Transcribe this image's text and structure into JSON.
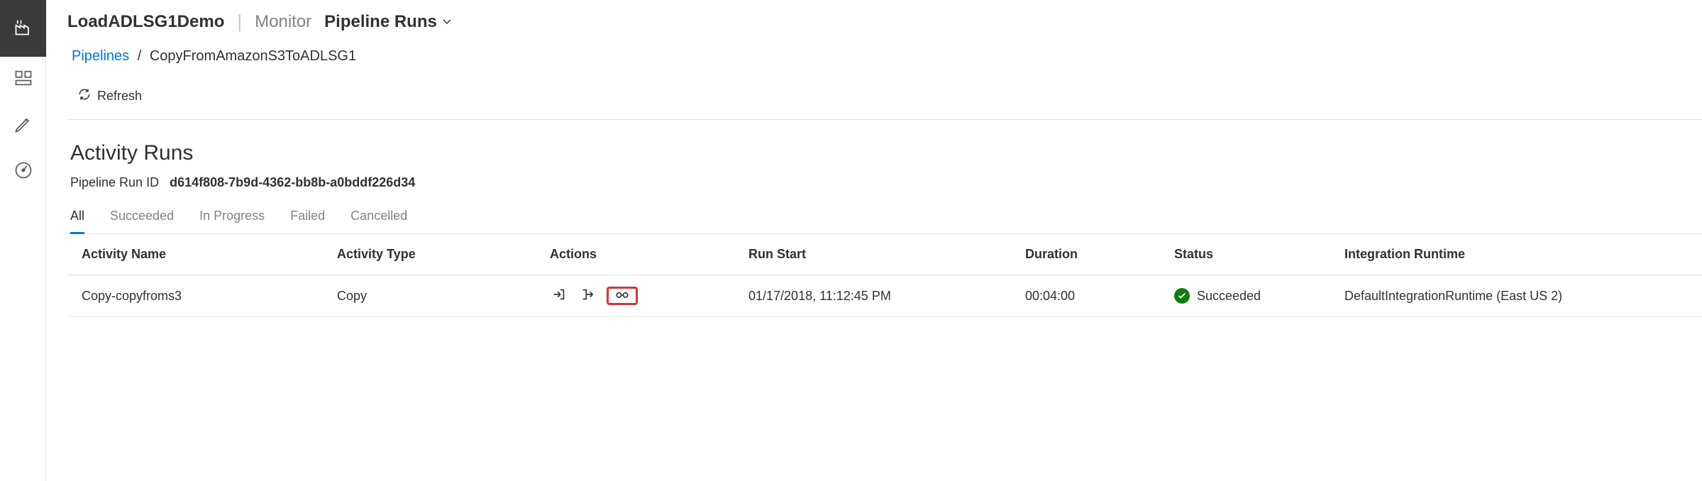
{
  "header": {
    "title": "LoadADLSG1Demo",
    "section_label": "Monitor",
    "dropdown_label": "Pipeline Runs"
  },
  "breadcrumb": {
    "link": "Pipelines",
    "current": "CopyFromAmazonS3ToADLSG1"
  },
  "toolbar": {
    "refresh_label": "Refresh"
  },
  "section": {
    "title": "Activity Runs",
    "run_id_label": "Pipeline Run ID",
    "run_id_value": "d614f808-7b9d-4362-bb8b-a0bddf226d34"
  },
  "filters": {
    "tabs": [
      "All",
      "Succeeded",
      "In Progress",
      "Failed",
      "Cancelled"
    ],
    "active_index": 0
  },
  "table": {
    "headers": {
      "activity_name": "Activity Name",
      "activity_type": "Activity Type",
      "actions": "Actions",
      "run_start": "Run Start",
      "duration": "Duration",
      "status": "Status",
      "runtime": "Integration Runtime"
    },
    "rows": [
      {
        "activity_name": "Copy-copyfroms3",
        "activity_type": "Copy",
        "run_start": "01/17/2018, 11:12:45 PM",
        "duration": "00:04:00",
        "status": "Succeeded",
        "runtime": "DefaultIntegrationRuntime (East US 2)"
      }
    ]
  }
}
